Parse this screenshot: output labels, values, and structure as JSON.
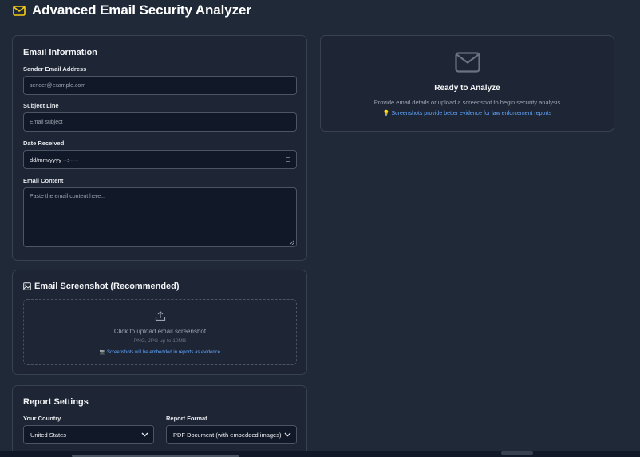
{
  "header": {
    "title": "Advanced Email Security Analyzer",
    "icon": "mail-icon",
    "accent": "#facc15"
  },
  "email_info": {
    "title": "Email Information",
    "sender_label": "Sender Email Address",
    "sender_placeholder": "sender@example.com",
    "subject_label": "Subject Line",
    "subject_placeholder": "Email subject",
    "date_label": "Date Received",
    "date_value": "dd/mm/yyyy --:-- --",
    "content_label": "Email Content",
    "content_placeholder": "Paste the email content here..."
  },
  "screenshot": {
    "title": "Email Screenshot (Recommended)",
    "upload_text": "Click to upload email screenshot",
    "formats": "PNG, JPG up to 10MB",
    "note": "📷 Screenshots will be embedded in reports as evidence"
  },
  "report": {
    "title": "Report Settings",
    "country_label": "Your Country",
    "country_value": "United States",
    "format_label": "Report Format",
    "format_value": "PDF Document (with embedded images)"
  },
  "status": {
    "title": "Ready to Analyze",
    "description": "Provide email details or upload a screenshot to begin security analysis",
    "tip": "💡 Screenshots provide better evidence for law enforcement reports"
  },
  "colors": {
    "background": "#1f2937",
    "card": "#1e2636",
    "input": "#111827",
    "link": "#60a5fa"
  }
}
